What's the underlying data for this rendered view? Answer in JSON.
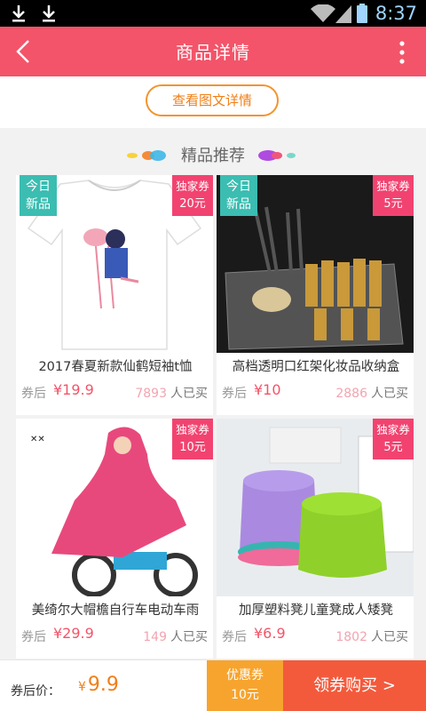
{
  "status_bar": {
    "time": "8:37"
  },
  "app_bar": {
    "title": "商品详情"
  },
  "detail_button": {
    "label": "查看图文详情"
  },
  "recommend": {
    "title": "精品推荐"
  },
  "products": [
    {
      "name": "2017春夏新款仙鹤短袖t恤",
      "after_label": "券后",
      "price": "¥19.9",
      "sold_count": "7893",
      "sold_label": "人已买",
      "new_tag": [
        "今日",
        "新品"
      ],
      "coupon_tag": "独家券",
      "coupon_value": "20元"
    },
    {
      "name": "高档透明口红架化妆品收纳盒",
      "after_label": "券后",
      "price": "¥10",
      "sold_count": "2886",
      "sold_label": "人已买",
      "new_tag": [
        "今日",
        "新品"
      ],
      "coupon_tag": "独家券",
      "coupon_value": "5元"
    },
    {
      "name": "美绮尔大帽檐自行车电动车雨",
      "after_label": "券后",
      "price": "¥29.9",
      "sold_count": "149",
      "sold_label": "人已买",
      "coupon_tag": "独家券",
      "coupon_value": "10元"
    },
    {
      "name": "加厚塑料凳儿童凳成人矮凳",
      "after_label": "券后",
      "price": "¥6.9",
      "sold_count": "1802",
      "sold_label": "人已买",
      "coupon_tag": "独家券",
      "coupon_value": "5元"
    }
  ],
  "bottom_bar": {
    "price_label": "券后价：",
    "price_symbol": "¥",
    "price_value": "9.9",
    "coupon_label": "优惠券",
    "coupon_value": "10元",
    "buy_label": "领券购买 >"
  },
  "colors": {
    "accent": "#f35469",
    "new_tag": "#3bbdb1",
    "coupon_tag": "#f24370",
    "orange": "#f7a42e",
    "buy": "#f35a3c"
  }
}
